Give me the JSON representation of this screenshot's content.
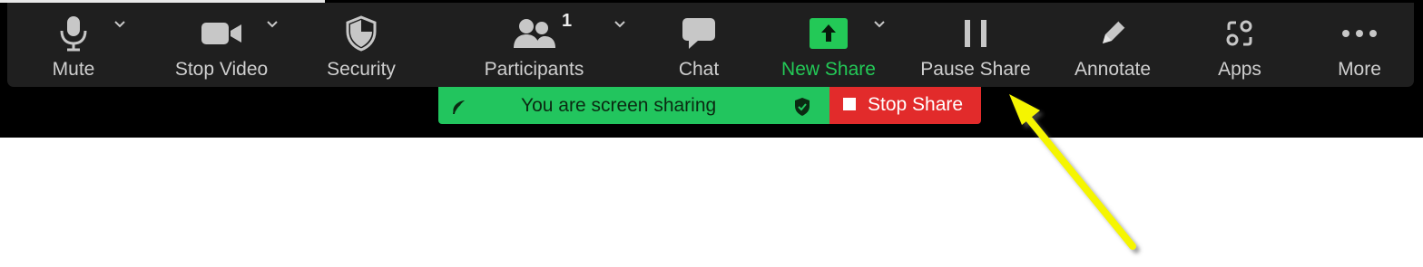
{
  "toolbar": {
    "mute_label": "Mute",
    "stop_video_label": "Stop Video",
    "security_label": "Security",
    "participants_label": "Participants",
    "participants_count": "1",
    "chat_label": "Chat",
    "new_share_label": "New Share",
    "pause_share_label": "Pause Share",
    "annotate_label": "Annotate",
    "apps_label": "Apps",
    "more_label": "More"
  },
  "share_bar": {
    "status_text": "You are screen sharing",
    "stop_share_label": "Stop Share"
  },
  "colors": {
    "toolbar_background": "#1f1f1f",
    "screen_share_green": "#22c55e",
    "stop_share_red": "#e22b2b",
    "annotation_arrow": "#f5f500"
  },
  "icons": {
    "mute": "microphone-icon",
    "stop_video": "video-camera-icon",
    "security": "shield-icon",
    "participants": "people-icon",
    "chat": "chat-bubble-icon",
    "new_share": "share-up-arrow-icon",
    "pause_share": "pause-icon",
    "annotate": "pencil-icon",
    "apps": "apps-icon",
    "more": "more-dots-icon",
    "status_left": "leaf-icon",
    "status_secure": "shield-check-icon",
    "stop_share": "stop-square-icon"
  }
}
